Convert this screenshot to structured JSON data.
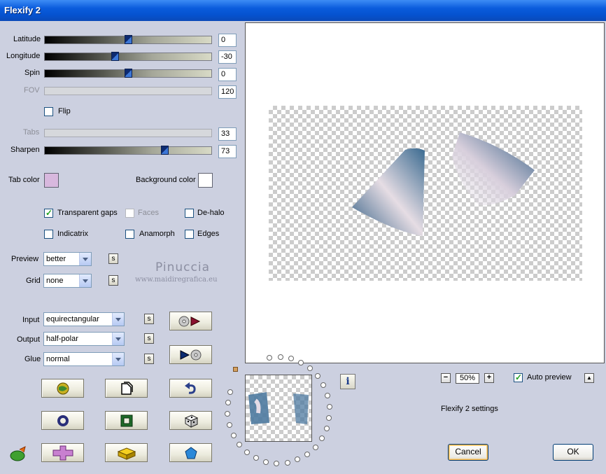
{
  "window": {
    "title": "Flexify 2"
  },
  "sliders": {
    "latitude": {
      "label": "Latitude",
      "value": "0",
      "fraction": 0.5,
      "enabled": true
    },
    "longitude": {
      "label": "Longitude",
      "value": "-30",
      "fraction": 0.42,
      "enabled": true
    },
    "spin": {
      "label": "Spin",
      "value": "0",
      "fraction": 0.5,
      "enabled": true
    },
    "fov": {
      "label": "FOV",
      "value": "120",
      "enabled": false
    },
    "tabs": {
      "label": "Tabs",
      "value": "33",
      "enabled": false
    },
    "sharpen": {
      "label": "Sharpen",
      "value": "73",
      "fraction": 0.72,
      "enabled": true
    }
  },
  "flip": {
    "label": "Flip",
    "checked": false
  },
  "colors": {
    "tab_color_label": "Tab color",
    "tab_color": "#d8b8de",
    "background_color_label": "Background color",
    "background_color": "#ffffff"
  },
  "options": {
    "transparent_gaps": {
      "label": "Transparent gaps",
      "checked": true
    },
    "faces": {
      "label": "Faces",
      "checked": false,
      "enabled": false
    },
    "de_halo": {
      "label": "De-halo",
      "checked": false
    },
    "indicatrix": {
      "label": "Indicatrix",
      "checked": false
    },
    "anamorph": {
      "label": "Anamorph",
      "checked": false
    },
    "edges": {
      "label": "Edges",
      "checked": false
    }
  },
  "selects": {
    "preview": {
      "label": "Preview",
      "value": "better"
    },
    "grid": {
      "label": "Grid",
      "value": "none"
    },
    "input": {
      "label": "Input",
      "value": "equirectangular"
    },
    "output": {
      "label": "Output",
      "value": "half-polar"
    },
    "glue": {
      "label": "Glue",
      "value": "normal"
    }
  },
  "small_button_label": "s",
  "watermark": {
    "line1": "Pinuccia",
    "line2": "www.maidiregrafica.eu"
  },
  "zoom": {
    "minus": "−",
    "value": "50%",
    "plus": "+"
  },
  "auto_preview": {
    "label": "Auto preview",
    "checked": true
  },
  "caret_label": "▲",
  "settings_label": "Flexify 2 settings",
  "buttons": {
    "cancel": "Cancel",
    "ok": "OK"
  },
  "info_label": "i"
}
